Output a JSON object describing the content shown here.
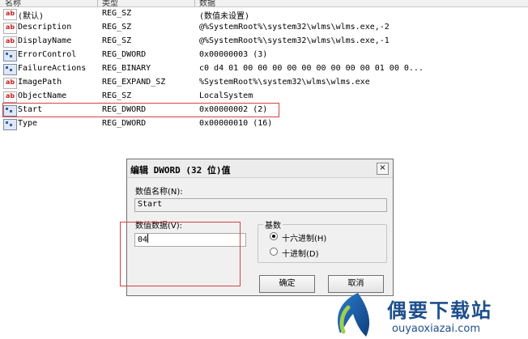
{
  "list": {
    "columns": [
      "名称",
      "类型",
      "数据"
    ],
    "rows": [
      {
        "icon": "string-value-icon",
        "name": "(默认)",
        "type": "REG_SZ",
        "data": "(数值未设置)"
      },
      {
        "icon": "string-value-icon",
        "name": "Description",
        "type": "REG_SZ",
        "data": "@%SystemRoot%\\system32\\wlms\\wlms.exe,-2"
      },
      {
        "icon": "string-value-icon",
        "name": "DisplayName",
        "type": "REG_SZ",
        "data": "@%SystemRoot%\\system32\\wlms\\wlms.exe,-1"
      },
      {
        "icon": "binary-value-icon",
        "name": "ErrorControl",
        "type": "REG_DWORD",
        "data": "0x00000003 (3)"
      },
      {
        "icon": "binary-value-icon",
        "name": "FailureActions",
        "type": "REG_BINARY",
        "data": "c0 d4 01 00 00 00 00 00 00 00 00 00 01 00 0..."
      },
      {
        "icon": "string-value-icon",
        "name": "ImagePath",
        "type": "REG_EXPAND_SZ",
        "data": "%SystemRoot%\\system32\\wlms\\wlms.exe"
      },
      {
        "icon": "string-value-icon",
        "name": "ObjectName",
        "type": "REG_SZ",
        "data": "LocalSystem"
      },
      {
        "icon": "binary-value-icon",
        "name": "Start",
        "type": "REG_DWORD",
        "data": "0x00000002 (2)"
      },
      {
        "icon": "binary-value-icon",
        "name": "Type",
        "type": "REG_DWORD",
        "data": "0x00000010 (16)"
      }
    ]
  },
  "dialog": {
    "title": "编辑 DWORD (32 位)值",
    "close": "×",
    "value_name_label": "数值名称(N):",
    "value_name": "Start",
    "value_data_label": "数值数据(V):",
    "value_data": "04",
    "base_label": "基数",
    "base_options": [
      "十六进制(H)",
      "十进制(D)"
    ],
    "selected_base": "十六进制(H)",
    "ok_label": "确定",
    "cancel_label": "取消"
  },
  "watermark": {
    "title": "偶要下载站",
    "url": "ouyaoxiazai.com"
  },
  "colors": {
    "highlight": "#d84040",
    "watermark": "#1e4f8c"
  }
}
